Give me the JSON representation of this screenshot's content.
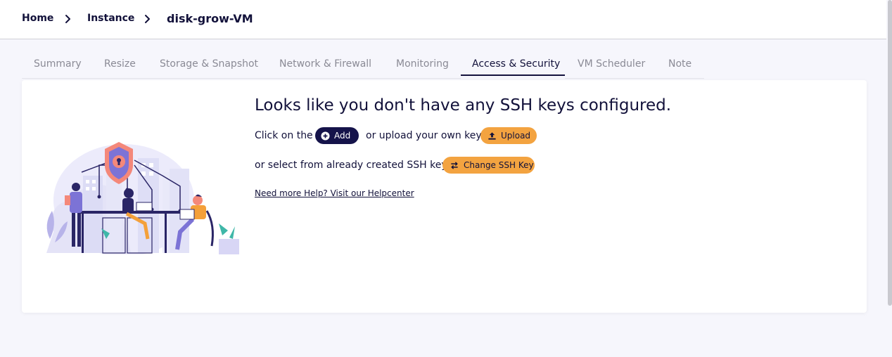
{
  "breadcrumb": {
    "home": "Home",
    "instance": "Instance",
    "current": "disk-grow-VM"
  },
  "tabs": [
    {
      "label": "Summary"
    },
    {
      "label": "Resize"
    },
    {
      "label": "Storage & Snapshot"
    },
    {
      "label": "Network & Firewall"
    },
    {
      "label": "Monitoring"
    },
    {
      "label": "Access & Security"
    },
    {
      "label": "VM Scheduler"
    },
    {
      "label": "Note"
    }
  ],
  "active_tab": "Access & Security",
  "empty_state": {
    "heading": "Looks like you don't have any SSH keys configured.",
    "line1_prefix": "Click on the",
    "add_label": "Add",
    "line1_suffix": "or upload your own key.",
    "upload_label": "Upload",
    "line2_prefix": "or select from already created SSH keys",
    "change_label": "Change SSH Key",
    "help_link": "Need more Help? Visit our Helpcenter"
  },
  "colors": {
    "primary_navy": "#15134a",
    "accent_orange": "#f3a340",
    "background": "#f6f6fc"
  },
  "icons": {
    "breadcrumb_separator": "chevron-right-icon",
    "add": "plus-circle-icon",
    "upload": "upload-icon",
    "change": "swap-arrows-icon"
  }
}
